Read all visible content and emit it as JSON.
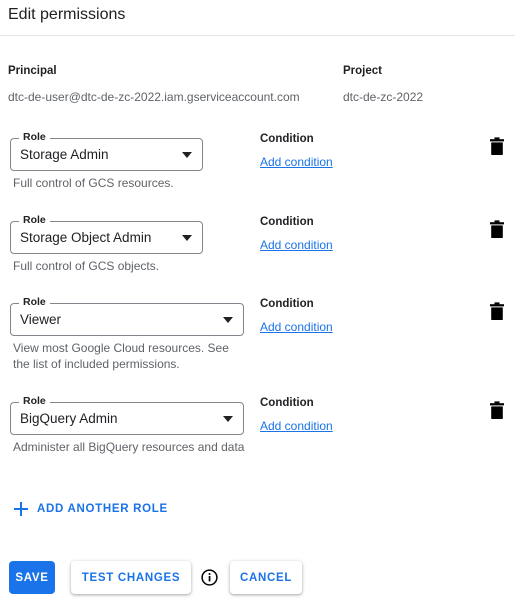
{
  "header": {
    "title": "Edit permissions"
  },
  "identity": {
    "principal_label": "Principal",
    "principal_value": "dtc-de-user@dtc-de-zc-2022.iam.gserviceaccount.com",
    "project_label": "Project",
    "project_value": "dtc-de-zc-2022"
  },
  "common": {
    "role_legend": "Role",
    "condition_label": "Condition",
    "add_condition_label": "Add condition",
    "delete_icon": "trash-icon",
    "dropdown_icon": "chevron-down-icon"
  },
  "roles": [
    {
      "legend": "Role",
      "value": "Storage Admin",
      "help": "Full control of GCS resources.",
      "condition_label": "Condition",
      "add_condition_label": "Add condition"
    },
    {
      "legend": "Role",
      "value": "Storage Object Admin",
      "help": "Full control of GCS objects.",
      "condition_label": "Condition",
      "add_condition_label": "Add condition"
    },
    {
      "legend": "Role",
      "value": "Viewer",
      "help": "View most Google Cloud resources. See the list of included permissions.",
      "condition_label": "Condition",
      "add_condition_label": "Add condition"
    },
    {
      "legend": "Role",
      "value": "BigQuery Admin",
      "help": "Administer all BigQuery resources and data",
      "condition_label": "Condition",
      "add_condition_label": "Add condition"
    }
  ],
  "add_role": {
    "label": "ADD ANOTHER ROLE",
    "icon": "plus-icon"
  },
  "footer": {
    "save_label": "SAVE",
    "test_changes_label": "TEST CHANGES",
    "cancel_label": "CANCEL",
    "info_icon": "info-icon"
  },
  "colors": {
    "accent": "#1a73e8",
    "text_primary": "#202124",
    "text_secondary": "#5f6368",
    "border": "#80868b",
    "divider": "#e6e6e6",
    "background": "#ffffff"
  }
}
